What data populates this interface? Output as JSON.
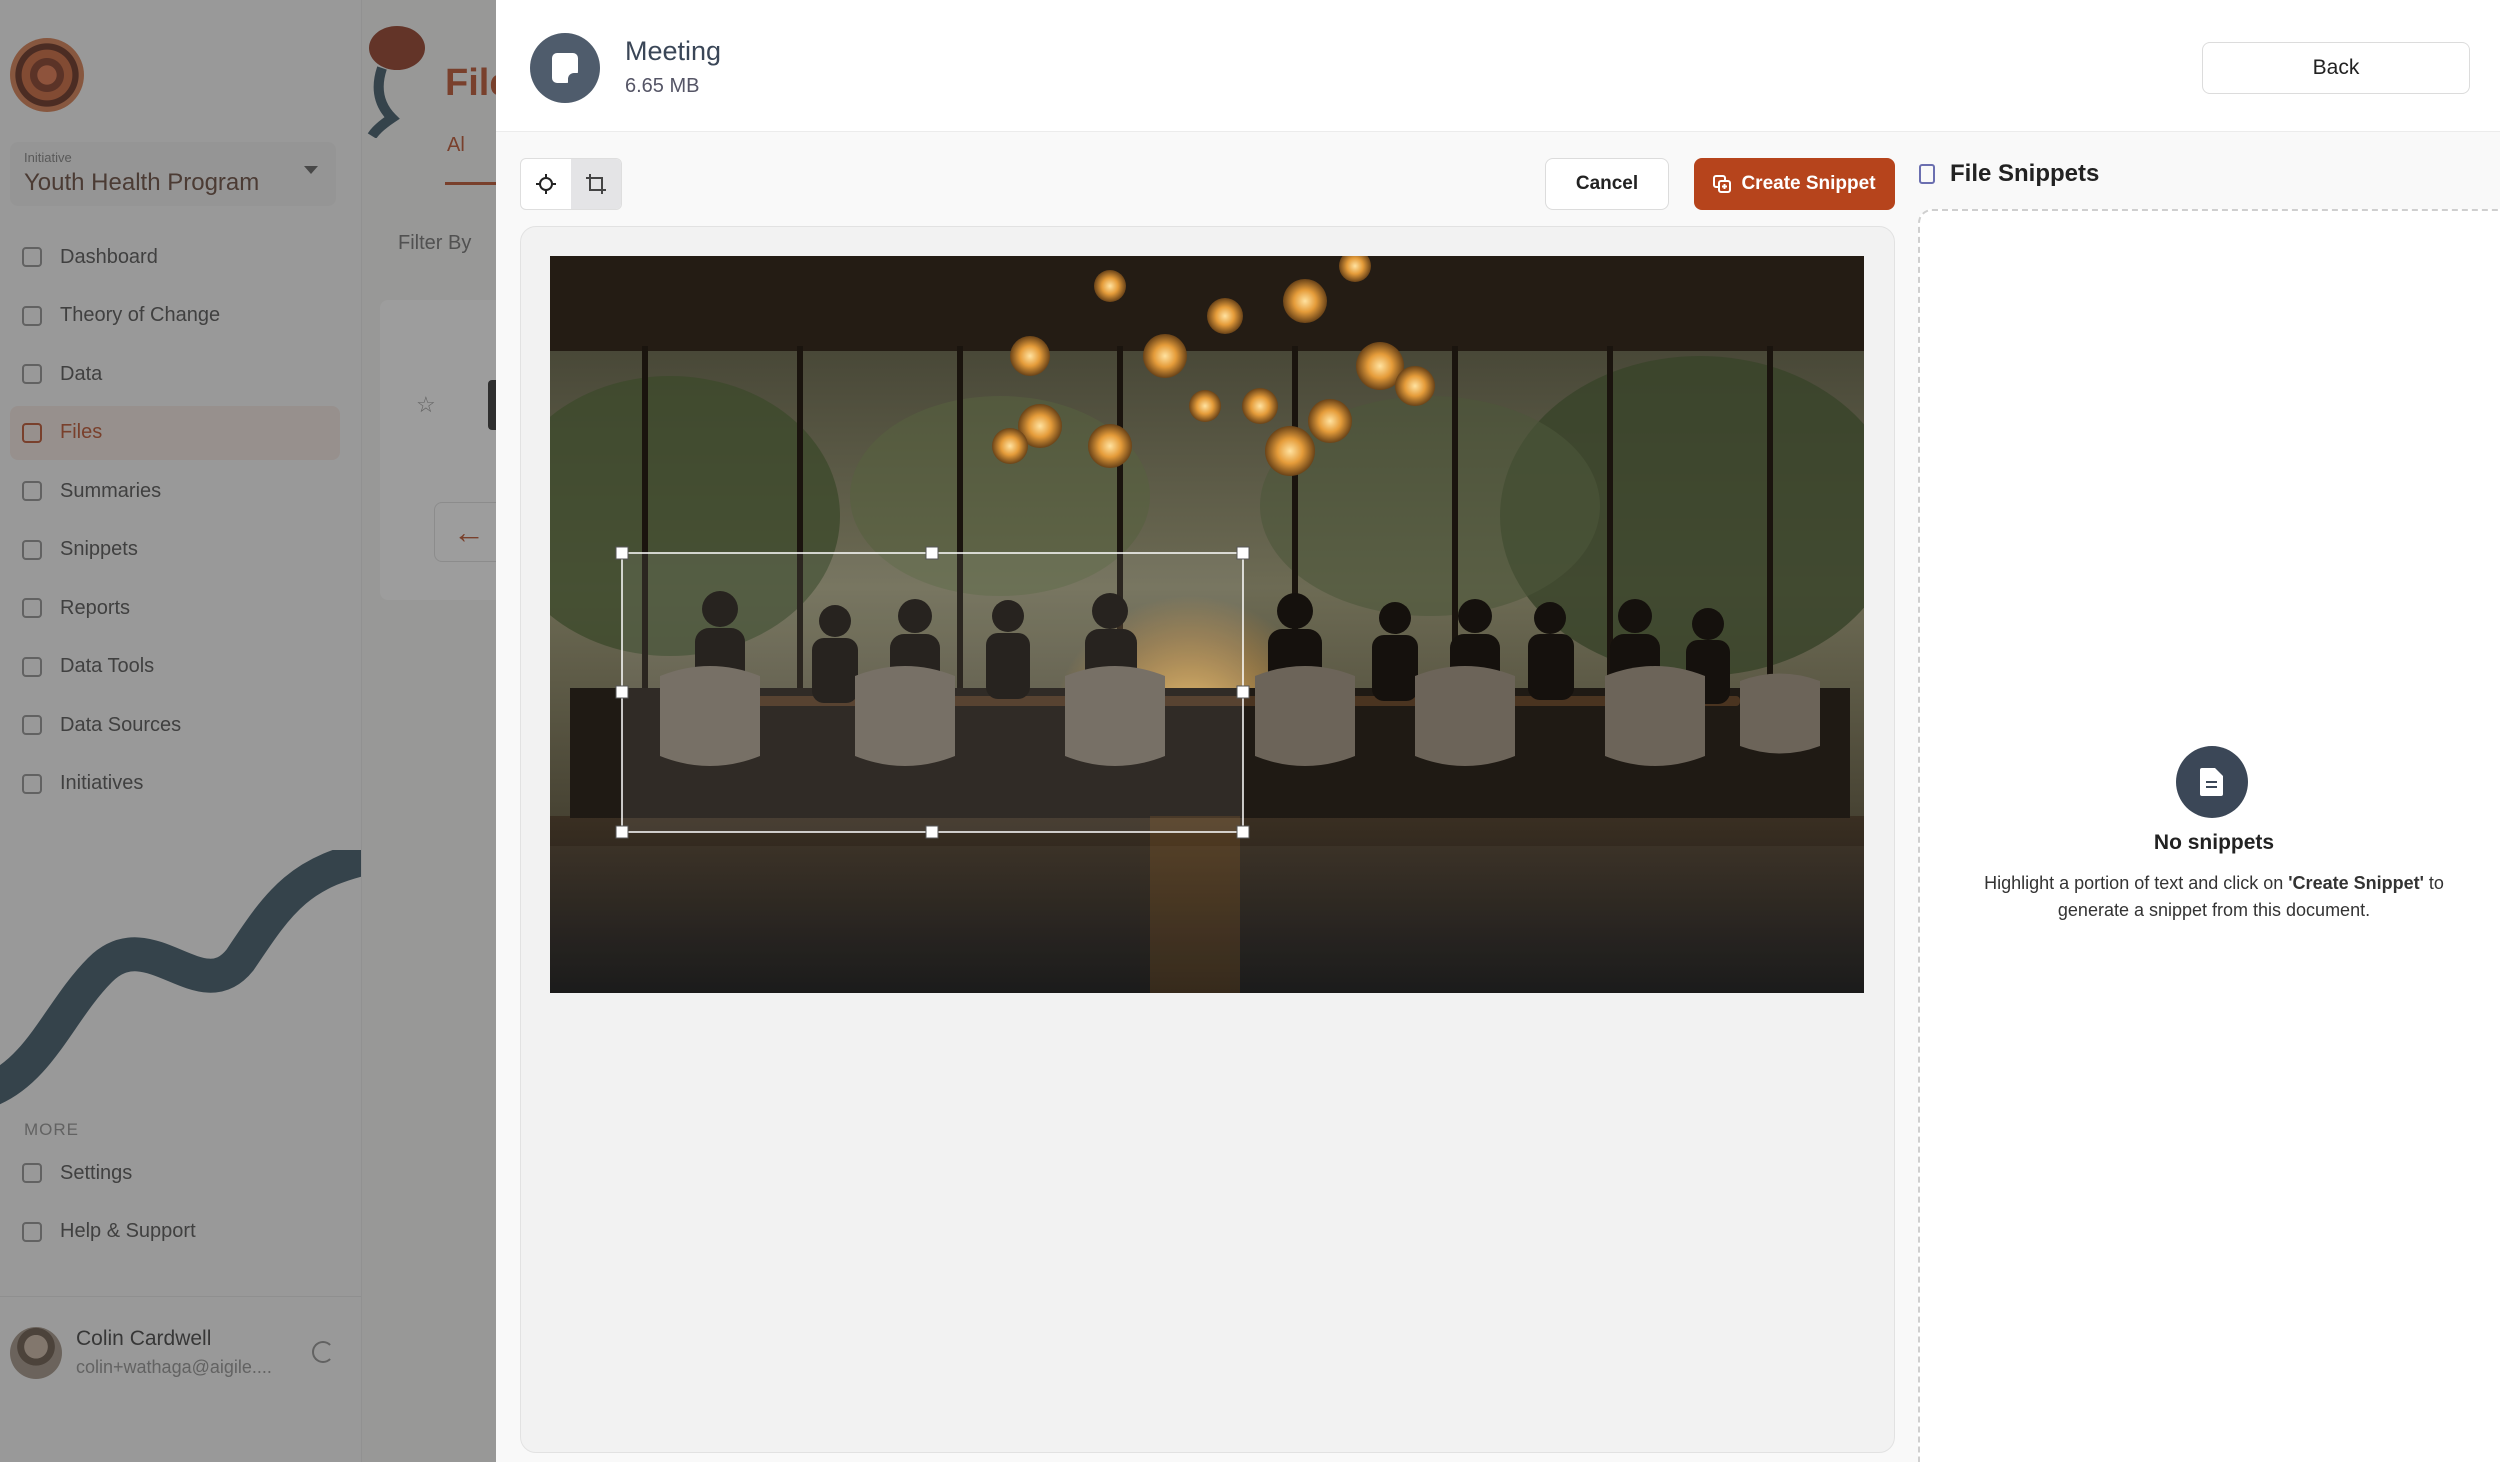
{
  "sidebar": {
    "initiative_label": "Initiative",
    "initiative_name": "Youth Health Program",
    "items": [
      {
        "label": "Dashboard"
      },
      {
        "label": "Theory of Change"
      },
      {
        "label": "Data"
      },
      {
        "label": "Files",
        "active": true
      },
      {
        "label": "Summaries"
      },
      {
        "label": "Snippets"
      },
      {
        "label": "Reports"
      },
      {
        "label": "Data Tools"
      },
      {
        "label": "Data Sources"
      },
      {
        "label": "Initiatives"
      }
    ],
    "more_label": "MORE",
    "more_items": [
      {
        "label": "Settings"
      },
      {
        "label": "Help & Support"
      }
    ],
    "user": {
      "name": "Colin Cardwell",
      "email": "colin+wathaga@aigile...."
    }
  },
  "background": {
    "page_title": "File",
    "tab_label": "Al",
    "filter_label": "Filter By",
    "back_arrow": "←",
    "star": "☆"
  },
  "drawer": {
    "file_name": "Meeting",
    "file_size": "6.65 MB",
    "back_label": "Back",
    "tools": [
      "crosshair-icon",
      "crop-icon"
    ],
    "cancel_label": "Cancel",
    "create_label": "Create Snippet",
    "snippets_title": "File Snippets",
    "empty_title": "No snippets",
    "empty_desc_prefix": "Highlight a portion of text and click on ",
    "empty_desc_action": "'Create Snippet'",
    "empty_desc_suffix": " to generate a snippet from this document."
  },
  "colors": {
    "accent": "#b6441c",
    "icon_dark": "#3b4757",
    "header_icon": "#4f5c6c"
  }
}
